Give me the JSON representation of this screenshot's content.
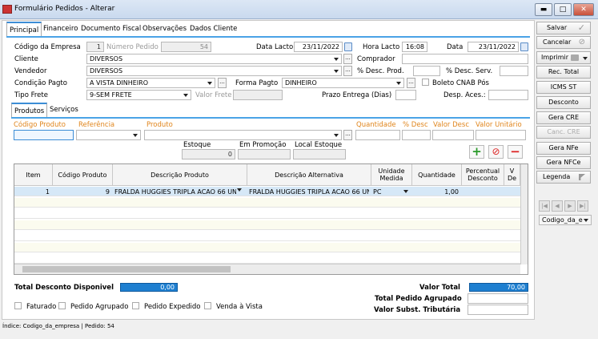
{
  "window": {
    "title": "Formulário Pedidos - Alterar",
    "min": "▬",
    "max": "□",
    "close": "✕"
  },
  "tabs": [
    "Principal",
    "Financeiro",
    "Documento Fiscal",
    "Observações",
    "Dados Cliente"
  ],
  "form": {
    "codigo_empresa_label": "Código da Empresa",
    "codigo_empresa": "1",
    "numero_pedido_label": "Número Pedido",
    "numero_pedido": "54",
    "data_lacto_label": "Data Lacto",
    "data_lacto": "23/11/2022",
    "hora_lacto_label": "Hora Lacto",
    "hora_lacto": "16:08",
    "data_label": "Data",
    "data": "23/11/2022",
    "cliente_label": "Cliente",
    "cliente": "DIVERSOS",
    "comprador_label": "Comprador",
    "vendedor_label": "Vendedor",
    "vendedor": "DIVERSOS",
    "desc_prod_label": "% Desc. Prod.",
    "desc_serv_label": "% Desc. Serv.",
    "condicao_label": "Condição Pagto",
    "condicao": "A VISTA DINHEIRO",
    "forma_label": "Forma Pagto",
    "forma": "DINHEIRO",
    "boleto_label": "Boleto CNAB Pós",
    "tipo_frete_label": "Tipo Frete",
    "tipo_frete": "9-SEM FRETE",
    "valor_frete_label": "Valor Frete",
    "prazo_label": "Prazo Entrega (Dias)",
    "desp_label": "Desp. Aces.:",
    "ellipsis": "..."
  },
  "subtabs": [
    "Produtos",
    "Serviços"
  ],
  "product_entry": {
    "codigo_label": "Código Produto",
    "referencia_label": "Referência",
    "produto_label": "Produto",
    "quantidade_label": "Quantidade",
    "desc_label": "% Desc",
    "valor_desc_label": "Valor Desc",
    "valor_unit_label": "Valor Unitário",
    "estoque_label": "Estoque",
    "estoque": "0",
    "promocao_label": "Em Promoção",
    "local_label": "Local Estoque"
  },
  "icons": {
    "add": "+",
    "cancel": "⊘",
    "remove": "−",
    "calendar": "calendar-icon",
    "check": "✓"
  },
  "grid": {
    "headers": [
      "Item",
      "Código Produto",
      "Descrição Produto",
      "Descrição Alternativa",
      "Unidade Medida",
      "Quantidade",
      "Percentual Desconto",
      "V De"
    ],
    "rows": [
      {
        "item": "1",
        "codigo": "9",
        "descricao": "FRALDA HUGGIES TRIPLA ACAO 66 UNI",
        "alternativa": "FRALDA HUGGIES TRIPLA ACAO 66 UNI",
        "unidade": "PC",
        "quantidade": "1,00"
      }
    ]
  },
  "totals": {
    "desconto_label": "Total Desconto Disponivel",
    "desconto": "0,00",
    "valor_total_label": "Valor Total",
    "valor_total": "70,00",
    "pedido_agrupado_label": "Total Pedido Agrupado",
    "subst_label": "Valor Subst. Tributária"
  },
  "checkboxes": [
    "Faturado",
    "Pedido Agrupado",
    "Pedido Expedido",
    "Venda à Vista"
  ],
  "side_buttons": {
    "salvar": "Salvar",
    "cancelar": "Cancelar",
    "imprimir": "Imprimir",
    "rec_total": "Rec. Total",
    "icms": "ICMS ST",
    "desconto": "Desconto",
    "gera_cre": "Gera CRE",
    "canc_cre": "Canc. CRE",
    "gera_nfe": "Gera NFe",
    "gera_nfce": "Gera NFCe",
    "legenda": "Legenda",
    "codigo_combo": "Codigo_da_e"
  },
  "status": "Índice: Codigo_da_empresa | Pedido: 54"
}
